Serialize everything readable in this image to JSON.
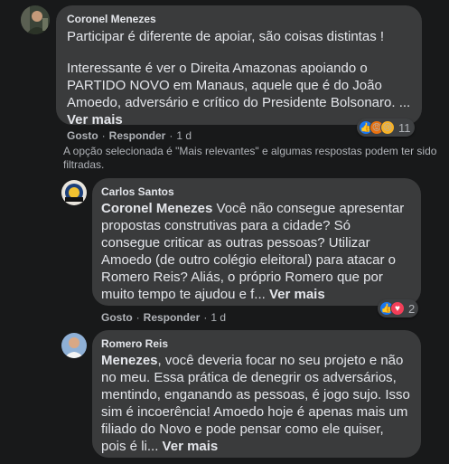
{
  "comments": [
    {
      "author": "Coronel Menezes",
      "paragraph1": "Participar é diferente de apoiar, são coisas distintas !",
      "paragraph2": "Interessante é ver o Direita Amazonas apoiando o PARTIDO NOVO em Manaus, aquele que é do João Amoedo, adversário e crítico do Presidente Bolsonaro. ...",
      "see_more": "Ver mais",
      "like_label": "Gosto",
      "reply_label": "Responder",
      "time": "1 d",
      "reaction_count": "11",
      "reactions": [
        "like-icon",
        "angry-icon",
        "sad-icon"
      ]
    },
    {
      "author": "Carlos Santos",
      "mention": "Coronel Menezes",
      "text": " Você não consegue apresentar propostas construtivas para a cidade? Só consegue criticar as outras pessoas? Utilizar Amoedo (de outro colégio eleitoral) para atacar o Romero Reis? Aliás, o próprio Romero que por muito tempo te ajudou e f...",
      "see_more": "Ver mais",
      "like_label": "Gosto",
      "reply_label": "Responder",
      "time": "1 d",
      "reaction_count": "2",
      "reactions": [
        "like-icon",
        "love-icon"
      ]
    },
    {
      "author": "Romero Reis",
      "mention": "Menezes",
      "text": ", você deveria focar no seu projeto e não no meu. Essa prática de denegrir os adversários, mentindo, enganando as pessoas, é jogo sujo. Isso sim é incoerência! Amoedo hoje é apenas mais um filiado do Novo e pode pensar como ele quiser, pois é li...",
      "see_more": "Ver mais"
    }
  ],
  "filter_note": "A opção selecionada é \"Mais relevantes\" e algumas respostas podem ter sido filtradas.",
  "separator": "·",
  "colors": {
    "background": "#18191a",
    "bubble": "#3a3b3c",
    "text": "#e4e6eb",
    "secondary": "#b0b3b8",
    "like": "#1877f2",
    "love": "#f33e58"
  }
}
